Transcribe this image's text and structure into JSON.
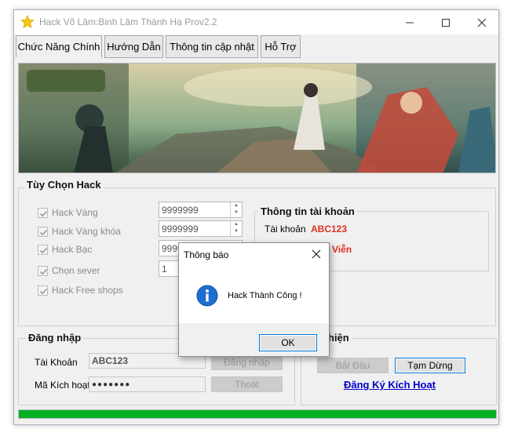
{
  "window": {
    "title": "Hack Võ Lâm:Binh Lâm Thành Hạ  Prov2.2",
    "icon": "star-icon",
    "controls": [
      "minimize-icon",
      "maximize-icon",
      "close-icon"
    ]
  },
  "tabs": [
    {
      "label": "Chức Năng Chính",
      "active": true
    },
    {
      "label": "Hướng Dẫn",
      "active": false
    },
    {
      "label": "Thông tin cập nhật",
      "active": false
    },
    {
      "label": "Hỗ Trợ",
      "active": false
    }
  ],
  "options": {
    "title": "Tùy Chọn Hack",
    "items": [
      {
        "label": "Hack Vàng",
        "checked": true,
        "value": "9999999"
      },
      {
        "label": "Hack Vàng khóa",
        "checked": true,
        "value": "9999999"
      },
      {
        "label": "Hack Bạc",
        "checked": true,
        "value": "9999999"
      },
      {
        "label": "Chọn sever",
        "checked": true,
        "value": "1"
      },
      {
        "label": "Hack Free shops",
        "checked": true
      }
    ]
  },
  "account_info": {
    "title": "Thông tin tài khoản",
    "account_label": "Tài khoản",
    "account_value": "ABC123",
    "vip_value": "Viễn",
    "value_color": "#e0301e"
  },
  "login": {
    "title": "Đăng nhập",
    "account_label": "Tài Khoản",
    "account_value": "ABC123",
    "code_label": "Mã Kích hoạt",
    "code_value": "●●●●●●●",
    "login_button": "Đăng nhập",
    "exit_button": "Thoát"
  },
  "execute": {
    "title": "hiện",
    "start_button": "Bắt Đầu",
    "pause_button": "Tạm Dừng",
    "register_link": "Đăng Ký Kích Hoạt",
    "link_color": "#0000cc"
  },
  "progress": {
    "percent": 100,
    "color": "#06b025"
  },
  "dialog": {
    "title": "Thông báo",
    "message": "Hack Thành Công !",
    "icon": "info-icon",
    "ok_label": "OK"
  }
}
